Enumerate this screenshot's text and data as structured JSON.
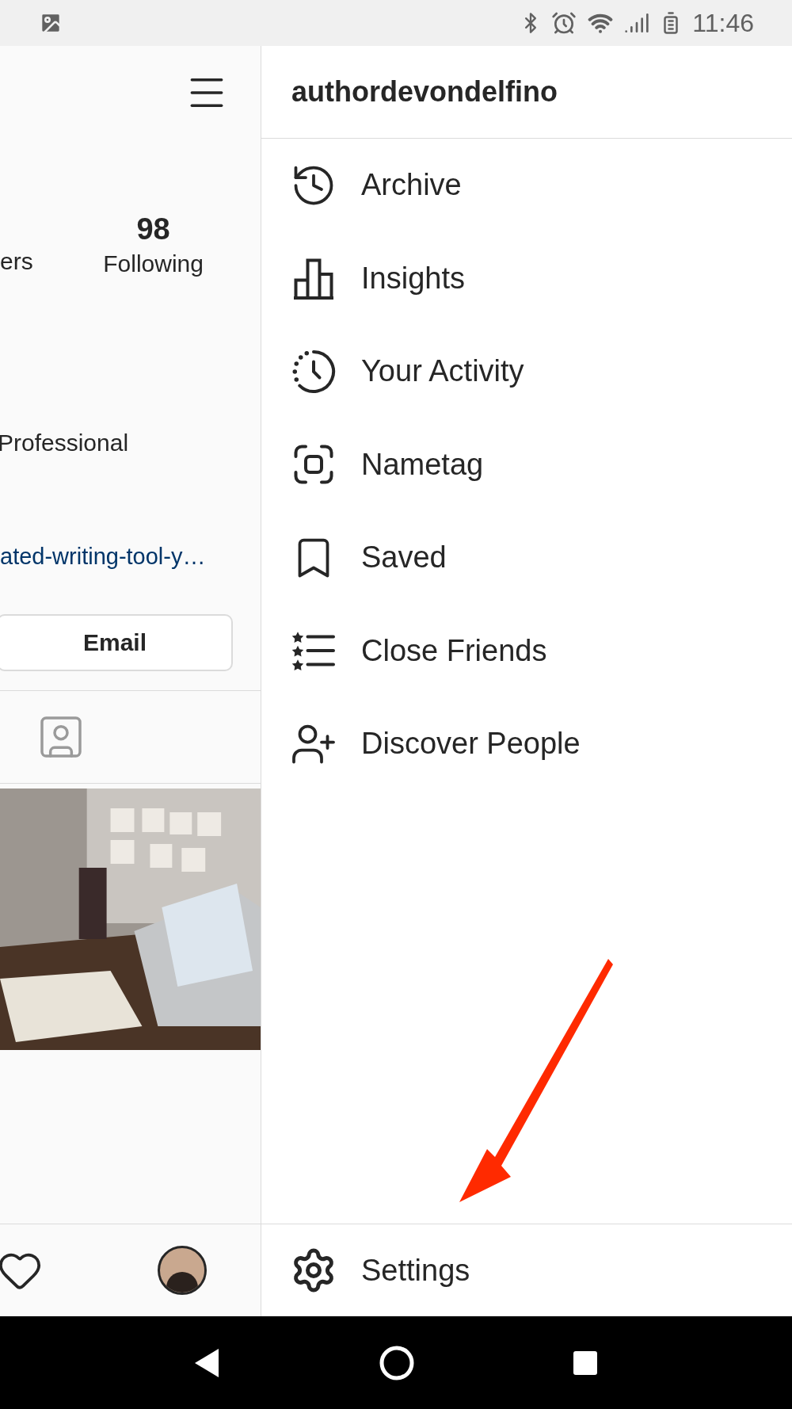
{
  "status_bar": {
    "time": "11:46"
  },
  "profile": {
    "followers_label": "ers",
    "following_count": "98",
    "following_label": "Following",
    "category": "Professional",
    "link": "ated-writing-tool-y…",
    "email_button": "Email"
  },
  "menu": {
    "username": "authordevondelfino",
    "items": [
      {
        "label": "Archive"
      },
      {
        "label": "Insights"
      },
      {
        "label": "Your Activity"
      },
      {
        "label": "Nametag"
      },
      {
        "label": "Saved"
      },
      {
        "label": "Close Friends"
      },
      {
        "label": "Discover People"
      }
    ],
    "settings": "Settings"
  }
}
